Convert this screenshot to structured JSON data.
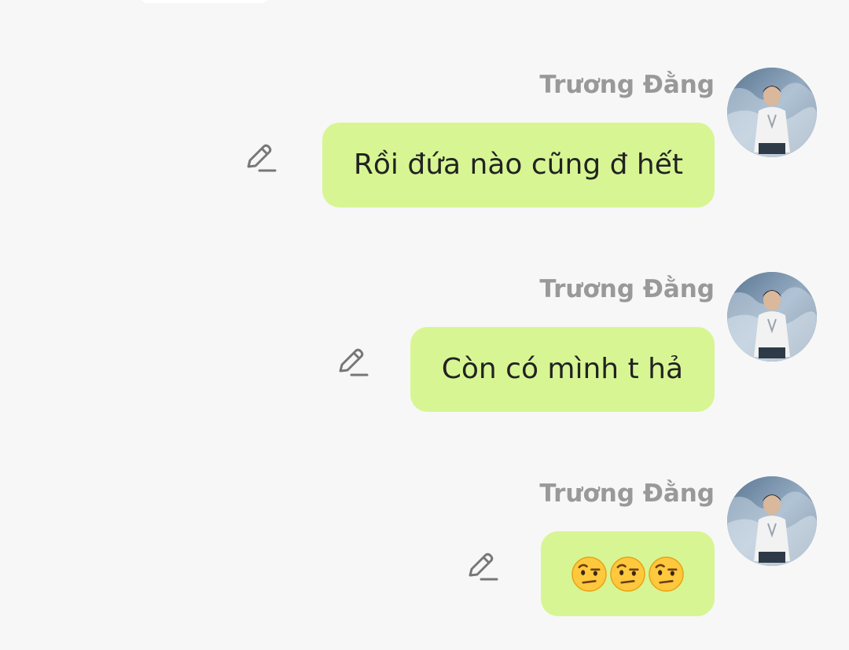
{
  "messages": [
    {
      "sender": "Trương Đằng",
      "text": "Rồi đứa nào cũng đ hết",
      "kind": "text"
    },
    {
      "sender": "Trương Đằng",
      "text": "Còn có mình t hả",
      "kind": "text"
    },
    {
      "sender": "Trương Đằng",
      "text": "",
      "kind": "emoji",
      "emoji_icons": [
        "face-with-raised-eyebrow-emoji",
        "face-with-raised-eyebrow-emoji",
        "face-with-raised-eyebrow-emoji"
      ]
    }
  ],
  "colors": {
    "background": "#f7f7f7",
    "bubble": "#d7f693",
    "sender_name": "#999999",
    "message_text": "#222222",
    "edit_icon": "#777777"
  },
  "icons": {
    "edit": "pencil-edit-icon",
    "avatar": "profile-photo-avatar"
  }
}
